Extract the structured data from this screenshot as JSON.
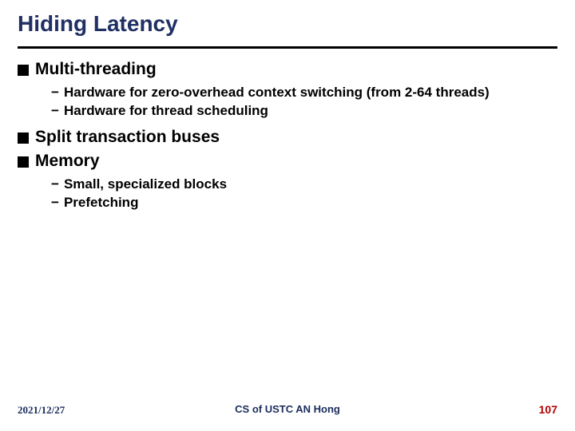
{
  "title": "Hiding Latency",
  "bullets": [
    {
      "label": "Multi-threading",
      "sub": [
        "Hardware for zero-overhead context switching (from 2-64 threads)",
        "Hardware for thread scheduling"
      ]
    },
    {
      "label": "Split transaction buses",
      "sub": []
    },
    {
      "label": "Memory",
      "sub": [
        "Small, specialized blocks",
        "Prefetching"
      ]
    }
  ],
  "footer": {
    "date": "2021/12/27",
    "center": "CS of USTC AN Hong",
    "page": "107"
  }
}
